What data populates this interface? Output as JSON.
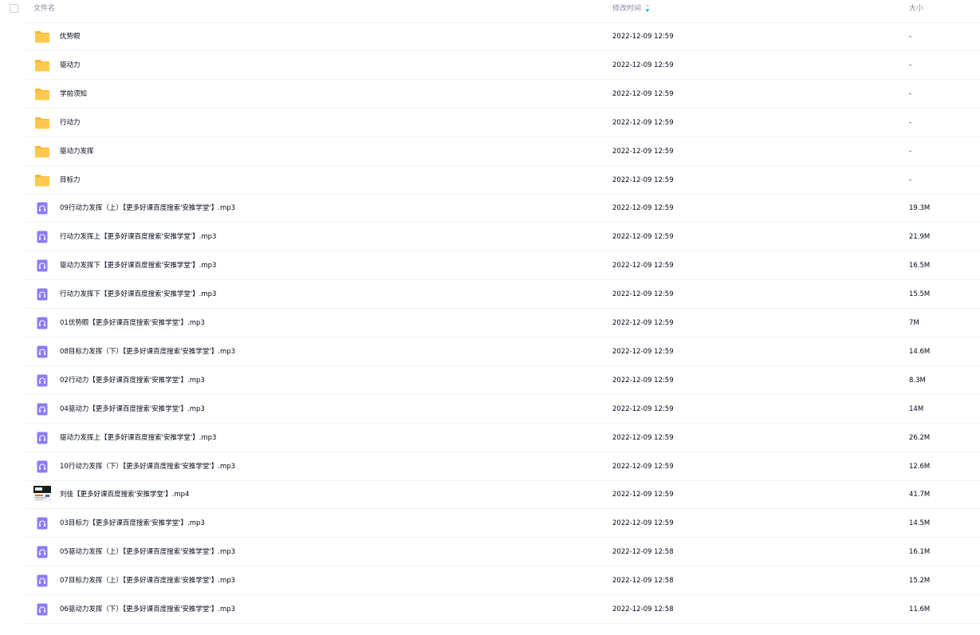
{
  "header": {
    "name": "文件名",
    "mtime": "修改时间",
    "size": "大小"
  },
  "files": [
    {
      "type": "folder",
      "icon": "folder-icon",
      "name": "优势眼",
      "mtime": "2022-12-09 12:59",
      "size": "-"
    },
    {
      "type": "folder",
      "icon": "folder-icon",
      "name": "驱动力",
      "mtime": "2022-12-09 12:59",
      "size": "-"
    },
    {
      "type": "folder",
      "icon": "folder-icon",
      "name": "学前须知",
      "mtime": "2022-12-09 12:59",
      "size": "-"
    },
    {
      "type": "folder",
      "icon": "folder-icon",
      "name": "行动力",
      "mtime": "2022-12-09 12:59",
      "size": "-"
    },
    {
      "type": "folder",
      "icon": "folder-icon",
      "name": "驱动力发挥",
      "mtime": "2022-12-09 12:59",
      "size": "-"
    },
    {
      "type": "folder",
      "icon": "folder-icon",
      "name": "目标力",
      "mtime": "2022-12-09 12:59",
      "size": "-"
    },
    {
      "type": "audio",
      "icon": "audio-file-icon",
      "name": "09行动力发挥（上）【更多好课百度搜索'安推学堂'】.mp3",
      "mtime": "2022-12-09 12:59",
      "size": "19.3M"
    },
    {
      "type": "audio",
      "icon": "audio-file-icon",
      "name": "行动力发挥上【更多好课百度搜索'安推学堂'】.mp3",
      "mtime": "2022-12-09 12:59",
      "size": "21.9M"
    },
    {
      "type": "audio",
      "icon": "audio-file-icon",
      "name": "驱动力发挥下【更多好课百度搜索'安推学堂'】.mp3",
      "mtime": "2022-12-09 12:59",
      "size": "16.5M"
    },
    {
      "type": "audio",
      "icon": "audio-file-icon",
      "name": "行动力发挥下【更多好课百度搜索'安推学堂'】.mp3",
      "mtime": "2022-12-09 12:59",
      "size": "15.5M"
    },
    {
      "type": "audio",
      "icon": "audio-file-icon",
      "name": "01优势眼【更多好课百度搜索'安推学堂'】.mp3",
      "mtime": "2022-12-09 12:59",
      "size": "7M"
    },
    {
      "type": "audio",
      "icon": "audio-file-icon",
      "name": "08目标力发挥（下）【更多好课百度搜索'安推学堂'】.mp3",
      "mtime": "2022-12-09 12:59",
      "size": "14.6M"
    },
    {
      "type": "audio",
      "icon": "audio-file-icon",
      "name": "02行动力【更多好课百度搜索'安推学堂'】.mp3",
      "mtime": "2022-12-09 12:59",
      "size": "8.3M"
    },
    {
      "type": "audio",
      "icon": "audio-file-icon",
      "name": "04驱动力【更多好课百度搜索'安推学堂'】.mp3",
      "mtime": "2022-12-09 12:59",
      "size": "14M"
    },
    {
      "type": "audio",
      "icon": "audio-file-icon",
      "name": "驱动力发挥上【更多好课百度搜索'安推学堂'】.mp3",
      "mtime": "2022-12-09 12:59",
      "size": "26.2M"
    },
    {
      "type": "audio",
      "icon": "audio-file-icon",
      "name": "10行动力发挥（下）【更多好课百度搜索'安推学堂'】.mp3",
      "mtime": "2022-12-09 12:59",
      "size": "12.6M"
    },
    {
      "type": "video",
      "icon": "video-thumbnail-icon",
      "name": "刘佳【更多好课百度搜索'安推学堂'】.mp4",
      "mtime": "2022-12-09 12:59",
      "size": "41.7M"
    },
    {
      "type": "audio",
      "icon": "audio-file-icon",
      "name": "03目标力【更多好课百度搜索'安推学堂'】.mp3",
      "mtime": "2022-12-09 12:59",
      "size": "14.5M"
    },
    {
      "type": "audio",
      "icon": "audio-file-icon",
      "name": "05驱动力发挥（上）【更多好课百度搜索'安推学堂'】.mp3",
      "mtime": "2022-12-09 12:58",
      "size": "16.1M"
    },
    {
      "type": "audio",
      "icon": "audio-file-icon",
      "name": "07目标力发挥（上）【更多好课百度搜索'安推学堂'】.mp3",
      "mtime": "2022-12-09 12:58",
      "size": "15.2M"
    },
    {
      "type": "audio",
      "icon": "audio-file-icon",
      "name": "06驱动力发挥（下）【更多好课百度搜索'安推学堂'】.mp3",
      "mtime": "2022-12-09 12:58",
      "size": "11.6M"
    }
  ],
  "colors": {
    "folder": "#ffc94d",
    "folder_dark": "#f5b72e",
    "audio": "#8b7cf6",
    "sort_accent": "#06a7ff"
  }
}
